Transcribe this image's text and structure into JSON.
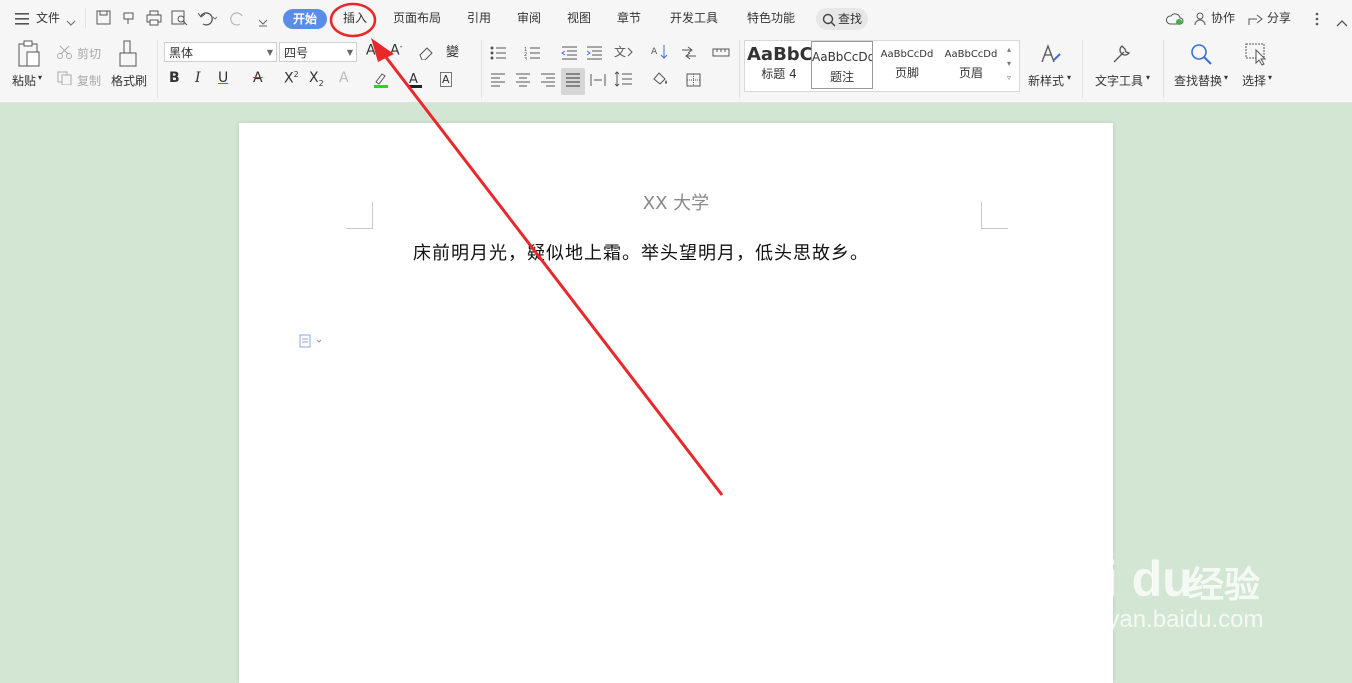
{
  "menubar": {
    "file_label": "文件",
    "tabs": [
      {
        "label": "开始",
        "active": true
      },
      {
        "label": "插入"
      },
      {
        "label": "页面布局"
      },
      {
        "label": "引用"
      },
      {
        "label": "审阅"
      },
      {
        "label": "视图"
      },
      {
        "label": "章节"
      },
      {
        "label": "开发工具"
      },
      {
        "label": "特色功能"
      }
    ],
    "search_label": "查找",
    "collab_label": "协作",
    "share_label": "分享"
  },
  "ribbon": {
    "paste_label": "粘贴",
    "cut_label": "剪切",
    "copy_label": "复制",
    "format_painter_label": "格式刷",
    "font_name": "黑体",
    "font_size": "四号",
    "styles": [
      {
        "preview": "AaBbC",
        "name": "标题 4"
      },
      {
        "preview": "AaBbCcDd",
        "name": "题注"
      },
      {
        "preview": "AaBbCcDd",
        "name": "页脚"
      },
      {
        "preview": "AaBbCcDd",
        "name": "页眉"
      }
    ],
    "new_style_label": "新样式",
    "text_tools_label": "文字工具",
    "find_replace_label": "查找替换",
    "select_label": "选择"
  },
  "document": {
    "header_text": "XX 大学",
    "body_text": "床前明月光，疑似地上霜。举头望明月，低头思故乡。"
  },
  "watermark": {
    "logo": "Bai du",
    "cn": "经验",
    "site": "jingyan.baidu.com"
  },
  "colors": {
    "accent": "#5a8de6",
    "annotation": "#e8282b",
    "background": "#d3e6d4"
  }
}
